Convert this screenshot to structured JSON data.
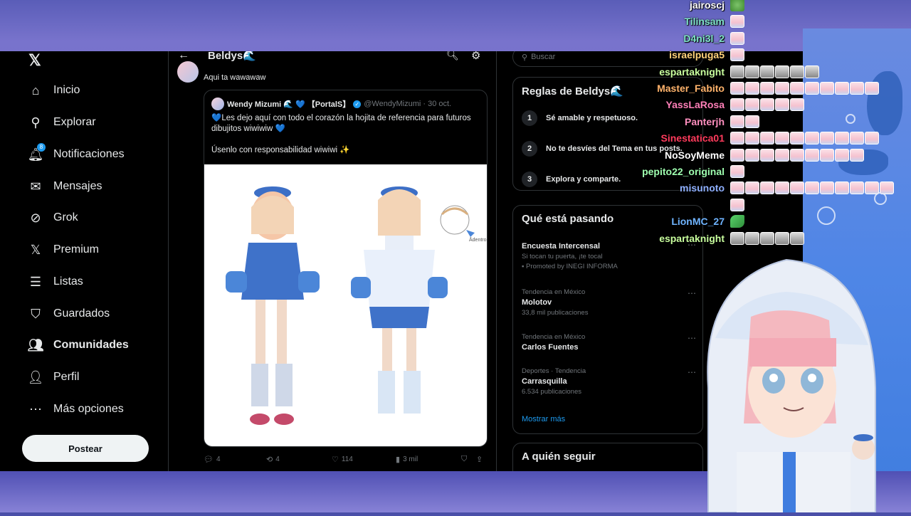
{
  "app": {
    "logo": "𝕏"
  },
  "nav": {
    "items": [
      {
        "label": "Inicio",
        "icon": "home-icon",
        "glyph": "⌂"
      },
      {
        "label": "Explorar",
        "icon": "search-icon",
        "glyph": "⚲"
      },
      {
        "label": "Notificaciones",
        "icon": "bell-icon",
        "glyph": "🔔︎",
        "badge": "8"
      },
      {
        "label": "Mensajes",
        "icon": "mail-icon",
        "glyph": "✉"
      },
      {
        "label": "Grok",
        "icon": "grok-icon",
        "glyph": "⊘"
      },
      {
        "label": "Premium",
        "icon": "x-premium-icon",
        "glyph": "𝕏"
      },
      {
        "label": "Listas",
        "icon": "list-icon",
        "glyph": "☰"
      },
      {
        "label": "Guardados",
        "icon": "bookmark-icon",
        "glyph": "⛉"
      },
      {
        "label": "Comunidades",
        "icon": "communities-icon",
        "glyph": "👥︎"
      },
      {
        "label": "Perfil",
        "icon": "profile-icon",
        "glyph": "👤︎"
      },
      {
        "label": "Más opciones",
        "icon": "more-icon",
        "glyph": "⋯"
      }
    ],
    "post_label": "Postear"
  },
  "center": {
    "title": "Beldys🌊",
    "reply_text": "Aqui ta wawawaw",
    "quote": {
      "name": "Wendy Mizumi 🌊 💙 【PortalS】",
      "handle": "@WendyMizumi · 30 oct.",
      "body_line1": "💙Les dejo aquí con todo el corazón la hojita de referencia para futuros dibujitos wiwiwiw 💙",
      "body_line2": "Úsenlo con responsabilidad wiwiwi ✨",
      "image_label": "Ādentro"
    },
    "actions": {
      "replies": "4",
      "reposts": "4",
      "likes": "114",
      "views": "3 mil"
    }
  },
  "right": {
    "search_placeholder": "Buscar",
    "rules_title": "Reglas de Beldys🌊",
    "rules": [
      {
        "num": "1",
        "text": "Sé amable y respetuoso."
      },
      {
        "num": "2",
        "text": "No te desvíes del Tema en tus posts."
      },
      {
        "num": "3",
        "text": "Explora y comparte."
      }
    ],
    "trends_title": "Qué está pasando",
    "trends": [
      {
        "meta": "",
        "name": "Encuesta Intercensal",
        "sub": "Si tocan tu puerta, ¡te tocal",
        "promo": "Promoted by INEGI INFORMA"
      },
      {
        "meta": "Tendencia en México",
        "name": "Molotov",
        "count": "33,8 mil publicaciones"
      },
      {
        "meta": "Tendencia en México",
        "name": "Carlos Fuentes",
        "count": ""
      },
      {
        "meta": "Deportes · Tendencia",
        "name": "Carrasquilla",
        "count": "6.534 publicaciones"
      }
    ],
    "show_more": "Mostrar más",
    "follow_title": "A quién seguir"
  },
  "chat": [
    {
      "user": "jairoscj",
      "color": "#ffffff",
      "emotes": [
        "frog"
      ]
    },
    {
      "user": "Tilinsam",
      "color": "#7fe3c8",
      "emotes": [
        "p"
      ]
    },
    {
      "user": "D4ni3l_2",
      "color": "#7fe3c8",
      "emotes": [
        "p"
      ]
    },
    {
      "user": "israelpuga5",
      "color": "#ffd27a",
      "emotes": [
        "p"
      ]
    },
    {
      "user": "espartaknight",
      "color": "#c9ff9e",
      "emotes": [
        "g",
        "g",
        "g",
        "g",
        "g",
        "g"
      ]
    },
    {
      "user": "Master_Fabito",
      "color": "#ffb36b",
      "emotes": [
        "p",
        "p",
        "p",
        "p",
        "p",
        "p",
        "p",
        "p",
        "p",
        "p"
      ]
    },
    {
      "user": "YassLaRosa",
      "color": "#ff7fb8",
      "emotes": [
        "p",
        "p",
        "p",
        "p",
        "p"
      ]
    },
    {
      "user": "Panterjh",
      "color": "#ff8fbf",
      "emotes": [
        "p",
        "p"
      ]
    },
    {
      "user": "Sinestatica01",
      "color": "#ff3b5c",
      "emotes": [
        "p",
        "p",
        "p",
        "p",
        "p",
        "p",
        "p",
        "p",
        "p",
        "p"
      ]
    },
    {
      "user": "NoSoyMeme",
      "color": "#ffffff",
      "emotes": [
        "p",
        "p",
        "p",
        "p",
        "p",
        "p",
        "p",
        "p",
        "p"
      ]
    },
    {
      "user": "pepito22_original",
      "color": "#9fffb0",
      "emotes": [
        "p"
      ]
    },
    {
      "user": "misunoto",
      "color": "#8fb0ff",
      "emotes": [
        "p",
        "p",
        "p",
        "p",
        "p",
        "p",
        "p",
        "p",
        "p",
        "p",
        "p"
      ]
    },
    {
      "user": "",
      "color": "#ffffff",
      "emotes": [
        "p"
      ]
    },
    {
      "user": "LionMC_27",
      "color": "#6fb4ff",
      "emotes": [
        "leaf"
      ]
    },
    {
      "user": "espartaknight",
      "color": "#c9ff9e",
      "emotes": [
        "g",
        "g",
        "g",
        "g",
        "g"
      ]
    }
  ]
}
